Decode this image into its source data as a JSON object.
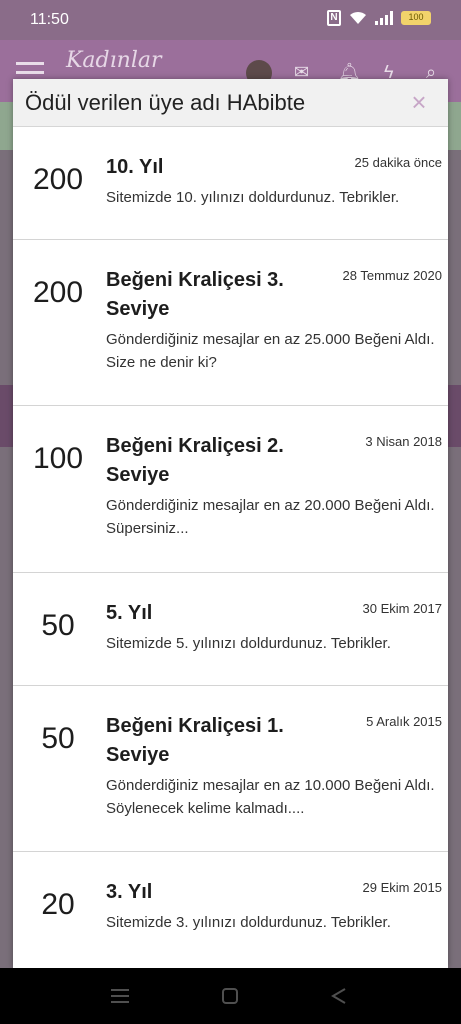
{
  "status_bar": {
    "time": "11:50",
    "battery": "100",
    "nfc": "N"
  },
  "app_bar": {
    "logo_text": "Kadınlar"
  },
  "modal": {
    "title": "Ödül verilen üye adı HAbibte",
    "close_icon": "×"
  },
  "trophies": [
    {
      "points": "200",
      "title": "10. Yıl",
      "date": "25 dakika önce",
      "description": "Sitemizde 10. yılınızı doldurdunuz. Tebrikler."
    },
    {
      "points": "200",
      "title": "Beğeni Kraliçesi 3. Seviye",
      "date": "28 Temmuz 2020",
      "description": "Gönderdiğiniz mesajlar en az 25.000 Beğeni Aldı. Size ne denir ki?"
    },
    {
      "points": "100",
      "title": "Beğeni Kraliçesi 2. Seviye",
      "date": "3 Nisan 2018",
      "description": "Gönderdiğiniz mesajlar en az 20.000 Beğeni Aldı. Süpersiniz..."
    },
    {
      "points": "50",
      "title": "5. Yıl",
      "date": "30 Ekim 2017",
      "description": "Sitemizde 5. yılınızı doldurdunuz. Tebrikler."
    },
    {
      "points": "50",
      "title": "Beğeni Kraliçesi 1. Seviye",
      "date": "5 Aralık 2015",
      "description": "Gönderdiğiniz mesajlar en az 10.000 Beğeni Aldı. Söylenecek kelime kalmadı...."
    },
    {
      "points": "20",
      "title": "3. Yıl",
      "date": "29 Ekim 2015",
      "description": "Sitemizde 3. yılınızı doldurdunuz. Tebrikler."
    }
  ],
  "icons": {
    "menu": "hamburger-icon",
    "mail": "mail-icon",
    "bell": "bell-icon",
    "bolt": "bolt-icon",
    "search": "search-icon",
    "nav_recent": "recent-apps-icon",
    "nav_home": "home-icon",
    "nav_back": "back-icon"
  }
}
